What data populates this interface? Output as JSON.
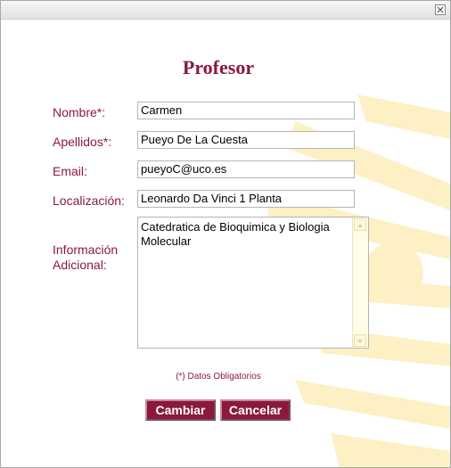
{
  "dialog": {
    "heading": "Profesor",
    "close_icon": "close-x-icon"
  },
  "form": {
    "nombre": {
      "label": "Nombre*:",
      "value": "Carmen"
    },
    "apellidos": {
      "label": "Apellidos*:",
      "value": "Pueyo De La Cuesta"
    },
    "email": {
      "label": "Email:",
      "value": "pueyoC@uco.es"
    },
    "localizacion": {
      "label": "Localización:",
      "value": "Leonardo Da Vinci 1 Planta"
    },
    "info": {
      "label_line1": "Información",
      "label_line2": "Adicional:",
      "value": "Catedratica de Bioquimica y Biologia Molecular"
    },
    "required_note": "(*) Datos Obligatorios"
  },
  "buttons": {
    "cambiar": "Cambiar",
    "cancelar": "Cancelar"
  },
  "colors": {
    "accent": "#8b1a3a",
    "watermark": "#fdf0c4"
  }
}
